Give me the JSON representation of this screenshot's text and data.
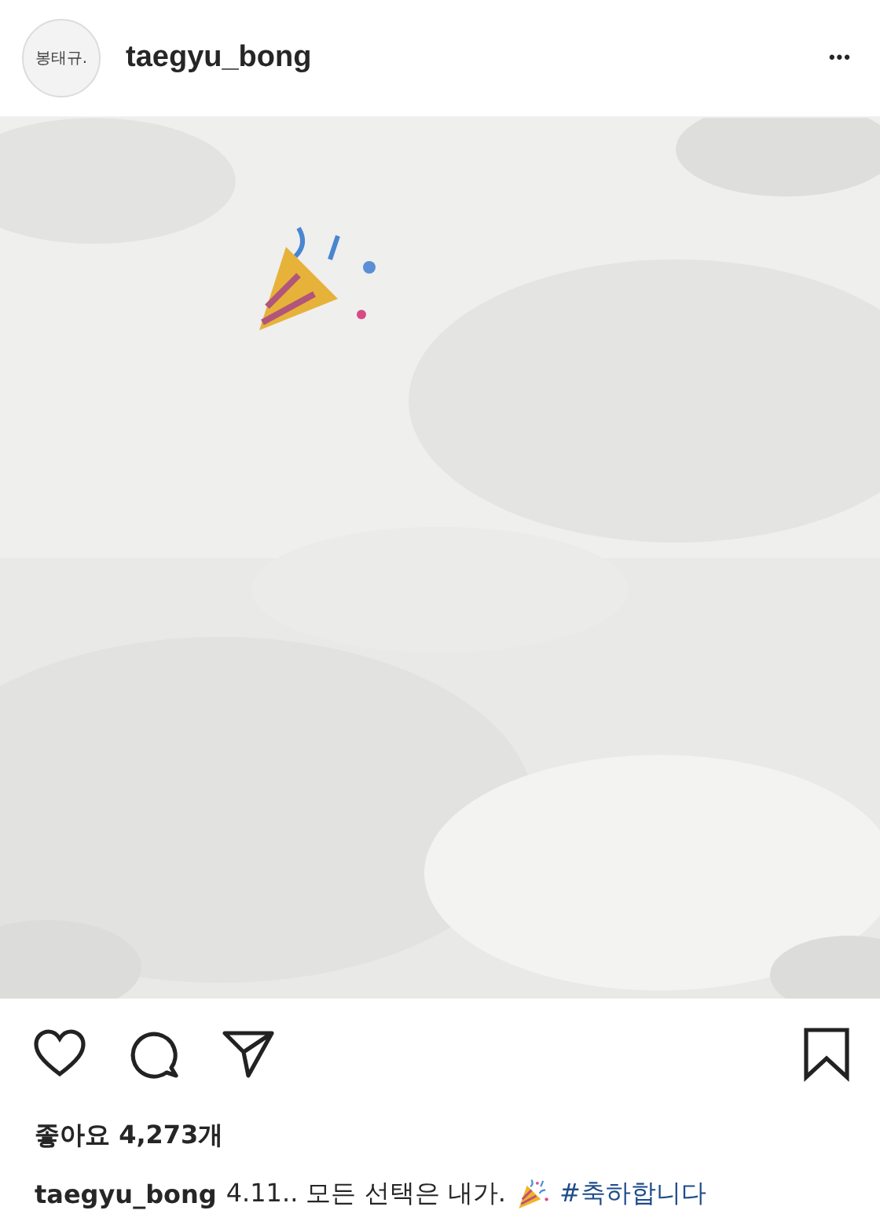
{
  "header": {
    "avatar_text": "봉태규.",
    "username": "taegyu_bong",
    "more": "•••"
  },
  "actions": {
    "liked": false,
    "saved": false
  },
  "likes": "좋아요 4,273개",
  "caption": {
    "username": "taegyu_bong",
    "text": "4.11.. 모든 선택은 내가.",
    "hashtag": "#축하합니다"
  }
}
